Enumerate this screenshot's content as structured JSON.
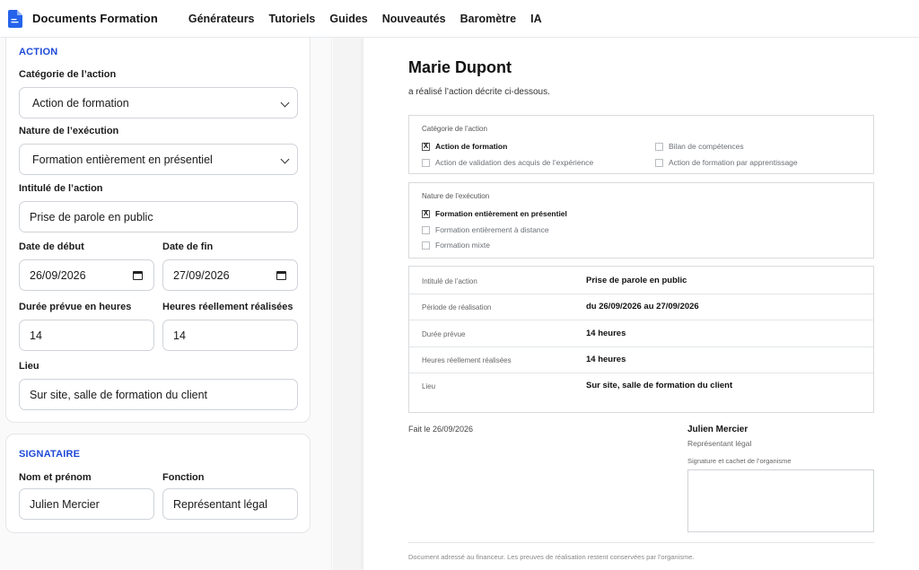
{
  "app": {
    "brand": "Documents Formation",
    "nav": [
      "Générateurs",
      "Tutoriels",
      "Guides",
      "Nouveautés",
      "Baromètre",
      "IA"
    ],
    "brand_color": "#2563eb"
  },
  "form": {
    "action": {
      "title": "ACTION",
      "category_label": "Catégorie de l’action",
      "category_value": "Action de formation",
      "nature_label": "Nature de l’exécution",
      "nature_value": "Formation entièrement en présentiel",
      "intitule_label": "Intitulé de l’action",
      "intitule_value": "Prise de parole en public",
      "start_label": "Date de début",
      "start_value": "26/09/2026",
      "end_label": "Date de fin",
      "end_value": "27/09/2026",
      "duree_label": "Durée prévue en heures",
      "duree_value": "14",
      "heures_label": "Heures réellement réalisées",
      "heures_value": "14",
      "lieu_label": "Lieu",
      "lieu_value": "Sur site, salle de formation du client"
    },
    "signataire": {
      "title": "SIGNATAIRE",
      "name_label": "Nom et prénom",
      "name_value": "Julien Mercier",
      "role_label": "Fonction",
      "role_value": "Représentant légal"
    }
  },
  "doc": {
    "name": "Marie Dupont",
    "subtitle": "a réalisé l’action décrite ci-dessous.",
    "category_caption": "Catégorie de l’action",
    "categories": [
      {
        "label": "Action de formation",
        "checked": true
      },
      {
        "label": "Bilan de compétences",
        "checked": false
      },
      {
        "label": "Action de validation des acquis de l’expérience",
        "checked": false
      },
      {
        "label": "Action de formation par apprentissage",
        "checked": false
      }
    ],
    "nature_caption": "Nature de l’exécution",
    "natures": [
      {
        "label": "Formation entièrement en présentiel",
        "checked": true
      },
      {
        "label": "Formation entièrement à distance",
        "checked": false
      },
      {
        "label": "Formation mixte",
        "checked": false
      }
    ],
    "check_mark": "X",
    "rows": [
      {
        "key": "Intitulé de l’action",
        "value": "Prise de parole en public"
      },
      {
        "key": "Période de réalisation",
        "value": "du 26/09/2026 au 27/09/2026"
      },
      {
        "key": "Durée prévue",
        "value": "14 heures"
      },
      {
        "key": "Heures réellement réalisées",
        "value": "14 heures"
      },
      {
        "key": "Lieu",
        "value": "Sur site, salle de formation du client"
      }
    ],
    "made_on": "Fait le 26/09/2026",
    "signer_name": "Julien Mercier",
    "signer_role": "Représentant légal",
    "signature_caption": "Signature et cachet de l’organisme",
    "footer": "Document adressé au financeur. Les preuves de réalisation restent conservées par l’organisme."
  }
}
